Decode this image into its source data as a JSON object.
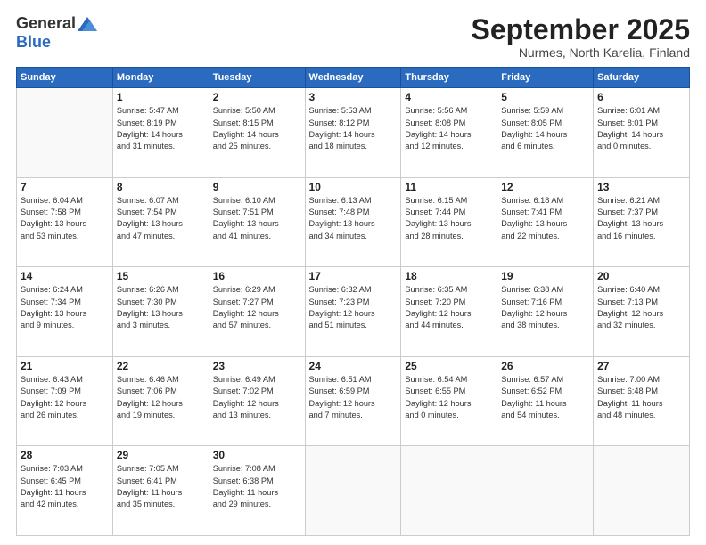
{
  "header": {
    "logo_general": "General",
    "logo_blue": "Blue",
    "title": "September 2025",
    "location": "Nurmes, North Karelia, Finland"
  },
  "days_of_week": [
    "Sunday",
    "Monday",
    "Tuesday",
    "Wednesday",
    "Thursday",
    "Friday",
    "Saturday"
  ],
  "weeks": [
    [
      {
        "day": "",
        "info": ""
      },
      {
        "day": "1",
        "info": "Sunrise: 5:47 AM\nSunset: 8:19 PM\nDaylight: 14 hours\nand 31 minutes."
      },
      {
        "day": "2",
        "info": "Sunrise: 5:50 AM\nSunset: 8:15 PM\nDaylight: 14 hours\nand 25 minutes."
      },
      {
        "day": "3",
        "info": "Sunrise: 5:53 AM\nSunset: 8:12 PM\nDaylight: 14 hours\nand 18 minutes."
      },
      {
        "day": "4",
        "info": "Sunrise: 5:56 AM\nSunset: 8:08 PM\nDaylight: 14 hours\nand 12 minutes."
      },
      {
        "day": "5",
        "info": "Sunrise: 5:59 AM\nSunset: 8:05 PM\nDaylight: 14 hours\nand 6 minutes."
      },
      {
        "day": "6",
        "info": "Sunrise: 6:01 AM\nSunset: 8:01 PM\nDaylight: 14 hours\nand 0 minutes."
      }
    ],
    [
      {
        "day": "7",
        "info": "Sunrise: 6:04 AM\nSunset: 7:58 PM\nDaylight: 13 hours\nand 53 minutes."
      },
      {
        "day": "8",
        "info": "Sunrise: 6:07 AM\nSunset: 7:54 PM\nDaylight: 13 hours\nand 47 minutes."
      },
      {
        "day": "9",
        "info": "Sunrise: 6:10 AM\nSunset: 7:51 PM\nDaylight: 13 hours\nand 41 minutes."
      },
      {
        "day": "10",
        "info": "Sunrise: 6:13 AM\nSunset: 7:48 PM\nDaylight: 13 hours\nand 34 minutes."
      },
      {
        "day": "11",
        "info": "Sunrise: 6:15 AM\nSunset: 7:44 PM\nDaylight: 13 hours\nand 28 minutes."
      },
      {
        "day": "12",
        "info": "Sunrise: 6:18 AM\nSunset: 7:41 PM\nDaylight: 13 hours\nand 22 minutes."
      },
      {
        "day": "13",
        "info": "Sunrise: 6:21 AM\nSunset: 7:37 PM\nDaylight: 13 hours\nand 16 minutes."
      }
    ],
    [
      {
        "day": "14",
        "info": "Sunrise: 6:24 AM\nSunset: 7:34 PM\nDaylight: 13 hours\nand 9 minutes."
      },
      {
        "day": "15",
        "info": "Sunrise: 6:26 AM\nSunset: 7:30 PM\nDaylight: 13 hours\nand 3 minutes."
      },
      {
        "day": "16",
        "info": "Sunrise: 6:29 AM\nSunset: 7:27 PM\nDaylight: 12 hours\nand 57 minutes."
      },
      {
        "day": "17",
        "info": "Sunrise: 6:32 AM\nSunset: 7:23 PM\nDaylight: 12 hours\nand 51 minutes."
      },
      {
        "day": "18",
        "info": "Sunrise: 6:35 AM\nSunset: 7:20 PM\nDaylight: 12 hours\nand 44 minutes."
      },
      {
        "day": "19",
        "info": "Sunrise: 6:38 AM\nSunset: 7:16 PM\nDaylight: 12 hours\nand 38 minutes."
      },
      {
        "day": "20",
        "info": "Sunrise: 6:40 AM\nSunset: 7:13 PM\nDaylight: 12 hours\nand 32 minutes."
      }
    ],
    [
      {
        "day": "21",
        "info": "Sunrise: 6:43 AM\nSunset: 7:09 PM\nDaylight: 12 hours\nand 26 minutes."
      },
      {
        "day": "22",
        "info": "Sunrise: 6:46 AM\nSunset: 7:06 PM\nDaylight: 12 hours\nand 19 minutes."
      },
      {
        "day": "23",
        "info": "Sunrise: 6:49 AM\nSunset: 7:02 PM\nDaylight: 12 hours\nand 13 minutes."
      },
      {
        "day": "24",
        "info": "Sunrise: 6:51 AM\nSunset: 6:59 PM\nDaylight: 12 hours\nand 7 minutes."
      },
      {
        "day": "25",
        "info": "Sunrise: 6:54 AM\nSunset: 6:55 PM\nDaylight: 12 hours\nand 0 minutes."
      },
      {
        "day": "26",
        "info": "Sunrise: 6:57 AM\nSunset: 6:52 PM\nDaylight: 11 hours\nand 54 minutes."
      },
      {
        "day": "27",
        "info": "Sunrise: 7:00 AM\nSunset: 6:48 PM\nDaylight: 11 hours\nand 48 minutes."
      }
    ],
    [
      {
        "day": "28",
        "info": "Sunrise: 7:03 AM\nSunset: 6:45 PM\nDaylight: 11 hours\nand 42 minutes."
      },
      {
        "day": "29",
        "info": "Sunrise: 7:05 AM\nSunset: 6:41 PM\nDaylight: 11 hours\nand 35 minutes."
      },
      {
        "day": "30",
        "info": "Sunrise: 7:08 AM\nSunset: 6:38 PM\nDaylight: 11 hours\nand 29 minutes."
      },
      {
        "day": "",
        "info": ""
      },
      {
        "day": "",
        "info": ""
      },
      {
        "day": "",
        "info": ""
      },
      {
        "day": "",
        "info": ""
      }
    ]
  ]
}
